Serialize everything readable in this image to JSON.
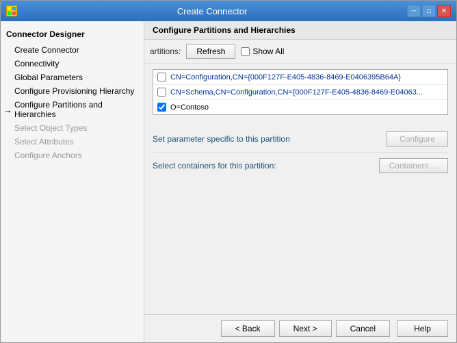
{
  "window": {
    "title": "Create Connector",
    "icon": "grid-icon"
  },
  "sidebar": {
    "header": "Connector Designer",
    "items": [
      {
        "id": "create-connector",
        "label": "Create Connector",
        "state": "normal",
        "indent": false
      },
      {
        "id": "connectivity",
        "label": "Connectivity",
        "state": "normal",
        "indent": true
      },
      {
        "id": "global-parameters",
        "label": "Global Parameters",
        "state": "normal",
        "indent": true
      },
      {
        "id": "configure-provisioning-hierarchy",
        "label": "Configure Provisioning Hierarchy",
        "state": "normal",
        "indent": true
      },
      {
        "id": "configure-partitions",
        "label": "Configure Partitions and Hierarchies",
        "state": "active-arrow",
        "indent": true
      },
      {
        "id": "select-object-types",
        "label": "Select Object Types",
        "state": "disabled",
        "indent": true
      },
      {
        "id": "select-attributes",
        "label": "Select Attributes",
        "state": "disabled",
        "indent": true
      },
      {
        "id": "configure-anchors",
        "label": "Configure Anchors",
        "state": "disabled",
        "indent": true
      }
    ]
  },
  "main": {
    "header": "Configure Partitions and Hierarchies",
    "toolbar": {
      "label": "artitions:",
      "refresh_label": "Refresh",
      "show_all_label": "Show All"
    },
    "partitions": [
      {
        "id": "partition-1",
        "label": "CN=Configuration,CN={000F127F-E405-4836-8469-E0406395B64A}",
        "checked": false
      },
      {
        "id": "partition-2",
        "label": "CN=Schema,CN=Configuration,CN={000F127F-E405-4836-8469-E04063...",
        "checked": false
      },
      {
        "id": "partition-3",
        "label": "O=Contoso",
        "checked": true
      }
    ],
    "settings": [
      {
        "id": "set-parameter",
        "label": "Set parameter specific to this partition",
        "button_label": "Configure",
        "disabled": true
      },
      {
        "id": "select-containers",
        "label": "Select containers for this partition:",
        "button_label": "Containers ...",
        "disabled": true
      }
    ]
  },
  "footer": {
    "back_label": "< Back",
    "next_label": "Next >",
    "cancel_label": "Cancel",
    "help_label": "Help"
  }
}
